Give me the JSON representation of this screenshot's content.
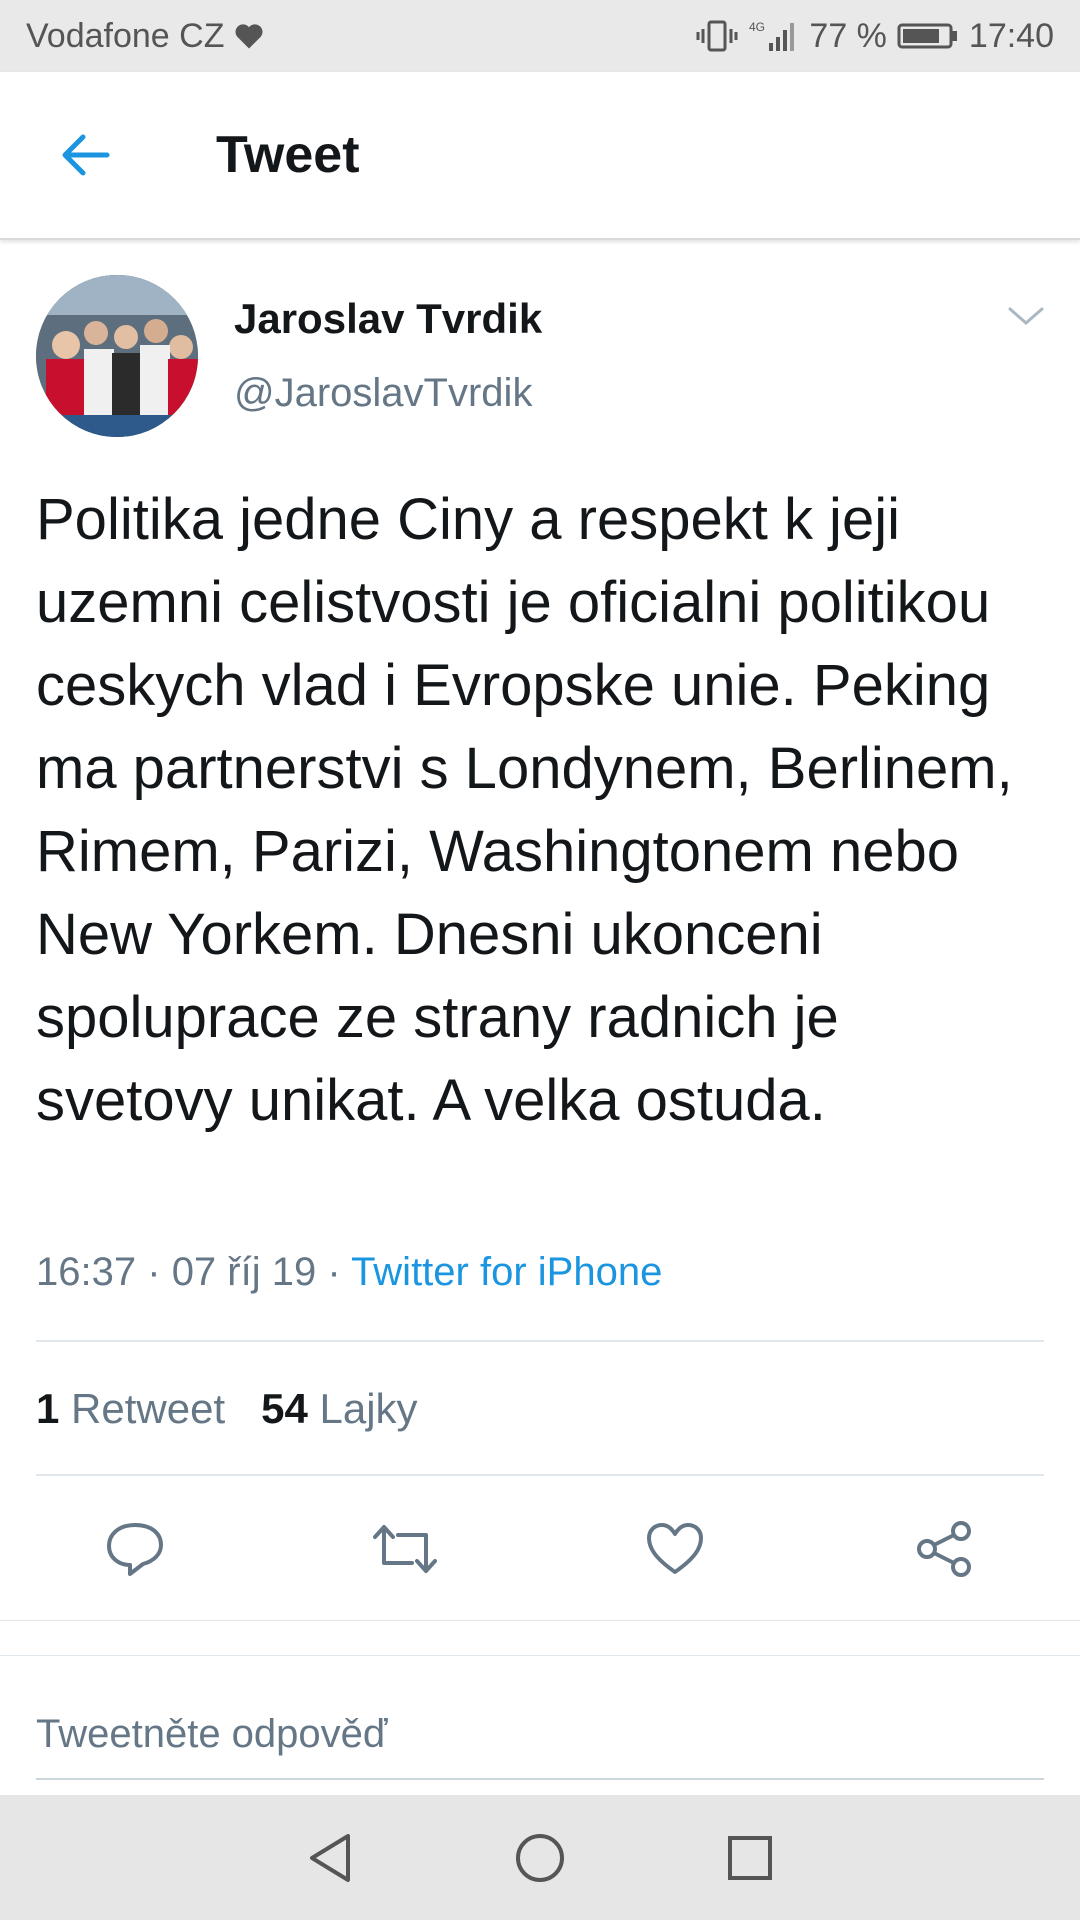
{
  "status_bar": {
    "carrier": "Vodafone CZ",
    "network": "4G",
    "battery": "77 %",
    "time": "17:40"
  },
  "header": {
    "title": "Tweet",
    "back_icon": "arrow-left-icon"
  },
  "tweet": {
    "author_name": "Jaroslav Tvrdik",
    "author_handle": "@JaroslavTvrdik",
    "text": "Politika jedne Ciny a respekt k jeji uzemni celistvosti je oficialni politikou ceskych vlad i Evropske unie. Peking ma partnerstvi s Londynem, Berlinem, Rimem, Parizi, Washingtonem nebo New Yorkem. Dnesni ukonceni spoluprace ze strany radnich je svetovy unikat. A velka ostuda.",
    "time": "16:37",
    "date": "07 říj 19",
    "separator": "·",
    "source": "Twitter for iPhone",
    "retweet_count": "1",
    "retweet_label": "Retweet",
    "like_count": "54",
    "like_label": "Lajky"
  },
  "actions": [
    "reply-icon",
    "retweet-icon",
    "like-icon",
    "share-icon"
  ],
  "reply": {
    "placeholder": "Tweetněte odpověď"
  },
  "nav": [
    "back-triangle-icon",
    "home-circle-icon",
    "recents-square-icon"
  ],
  "colors": {
    "accent": "#1b95e0",
    "secondary_text": "#657786",
    "primary_text": "#14171a"
  }
}
